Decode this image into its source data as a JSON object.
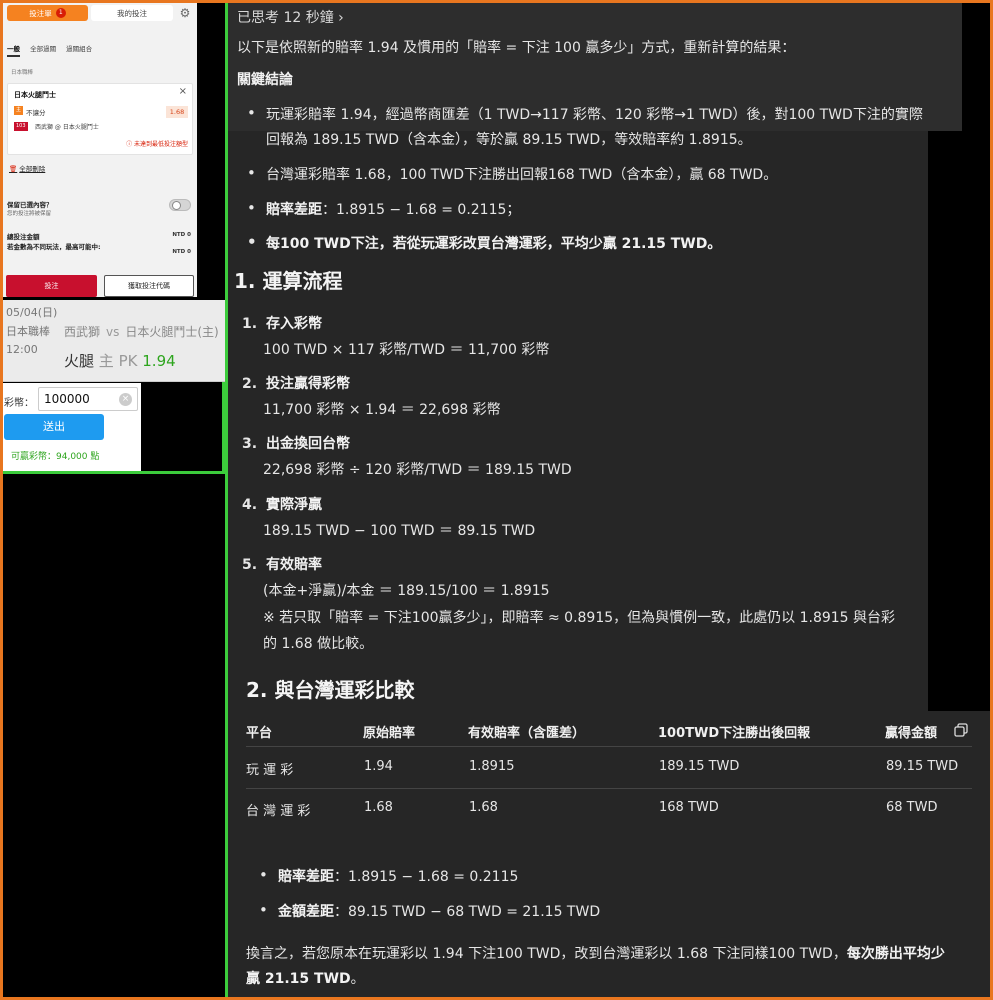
{
  "slip": {
    "tab_active": "投注單",
    "tab_count": "1",
    "tab_mybets": "我的投注",
    "subtabs": [
      "一般",
      "全部過關",
      "過關組合"
    ],
    "league": "日本職棒",
    "team": "日本火腿鬥士",
    "pick_badge": "主",
    "pick": "不讓分",
    "odds": "1.68",
    "match_id": "103",
    "matchup": "西武獅 @ 日本火腿鬥士",
    "warning": "未達到最低投注額型",
    "clear_all": "全部刪除",
    "keep_title": "保留已選內容？",
    "keep_sub": "您的投注將被保留",
    "total_stake_label": "總投注金額",
    "total_stake_value": "NTD 0",
    "max_win_label": "若金數為不同玩法，最高可能中:",
    "max_win_value": "NTD 0",
    "bet_button": "投注",
    "code_button": "獲取投注代碼"
  },
  "match": {
    "date": "05/04(日)",
    "league": "日本職棒",
    "time": "12:00",
    "away": "西武獅",
    "vs": "vs",
    "home": "日本火腿鬥士(主)",
    "bet_team": "火腿",
    "bet_side": "主",
    "bet_type": "PK",
    "bet_odds": "1.94"
  },
  "stake": {
    "label": "彩幣：",
    "value": "100000",
    "send_button": "送出",
    "available": "可贏彩幣：94,000 點"
  },
  "chat": {
    "thought": "已思考 12 秒鐘  ›",
    "intro": "以下是依照新的賠率 1.94 及慣用的「賠率 = 下注 100 贏多少」方式，重新計算的結果：",
    "key_heading": "關鍵結論",
    "key_points": [
      "玩運彩賠率 1.94，經過幣商匯差（1 TWD→117 彩幣、120 彩幣→1 TWD）後，對100 TWD下注的實際",
      "回報為 189.15 TWD（含本金），等於贏 89.15 TWD，等效賠率約 1.8915。",
      "台灣運彩賠率 1.68，100 TWD下注勝出回報168 TWD（含本金），贏 68 TWD。",
      "賠率差距",
      "：1.8915 − 1.68 = 0.2115；",
      "每100 TWD下注，若從玩運彩改買台灣運彩，平均少贏 21.15 TWD。"
    ],
    "section1": "1. 運算流程",
    "steps": [
      {
        "n": "1.",
        "title": "存入彩幣",
        "line": "100 TWD × 117 彩幣/TWD ＝ 11,700 彩幣"
      },
      {
        "n": "2.",
        "title": "投注贏得彩幣",
        "line": "11,700 彩幣 × 1.94 ＝ 22,698 彩幣"
      },
      {
        "n": "3.",
        "title": "出金換回台幣",
        "line": "22,698 彩幣 ÷ 120 彩幣/TWD ＝ 189.15 TWD"
      },
      {
        "n": "4.",
        "title": "實際淨贏",
        "line": "189.15 TWD − 100 TWD ＝ 89.15 TWD"
      },
      {
        "n": "5.",
        "title": "有效賠率",
        "line": "(本金+淨贏)/本金 ＝ 189.15/100 ＝ 1.8915"
      }
    ],
    "note1": "※ 若只取「賠率 = 下注100贏多少」，即賠率 ≈ 0.8915，但為與慣例一致，此處仍以 1.8915 與台彩",
    "note2": "的 1.68 做比較。",
    "section2": "2. 與台灣運彩比較",
    "table": {
      "headers": [
        "平台",
        "原始賠率",
        "有效賠率（含匯差）",
        "100TWD下注勝出後回報",
        "贏得金額"
      ],
      "rows": [
        [
          "玩 運 彩",
          "1.94",
          "1.8915",
          "189.15 TWD",
          "89.15 TWD"
        ],
        [
          "台 灣 運 彩",
          "1.68",
          "1.68",
          "168 TWD",
          "68 TWD"
        ]
      ]
    },
    "summary": [
      {
        "label": "賠率差距",
        "text": "：1.8915 − 1.68 = 0.2115"
      },
      {
        "label": "金額差距",
        "text": "：89.15 TWD − 68 TWD = 21.15 TWD"
      }
    ],
    "closing1": "換言之，若您原本在玩運彩以 1.94 下注100 TWD，改到台灣運彩以 1.68 下注同樣100 TWD，",
    "closing1_bold": "每次勝出平均少",
    "closing2_bold": "贏 21.15 TWD",
    "closing2": "。"
  },
  "colors": {
    "frame": "#e8761f",
    "divider": "#3ccc3c",
    "slip_accent": "#f58220",
    "bet_button": "#c8102e",
    "send_button": "#1e9bf0",
    "odds_green": "#2ea51e",
    "chat_bg": "#262626"
  }
}
